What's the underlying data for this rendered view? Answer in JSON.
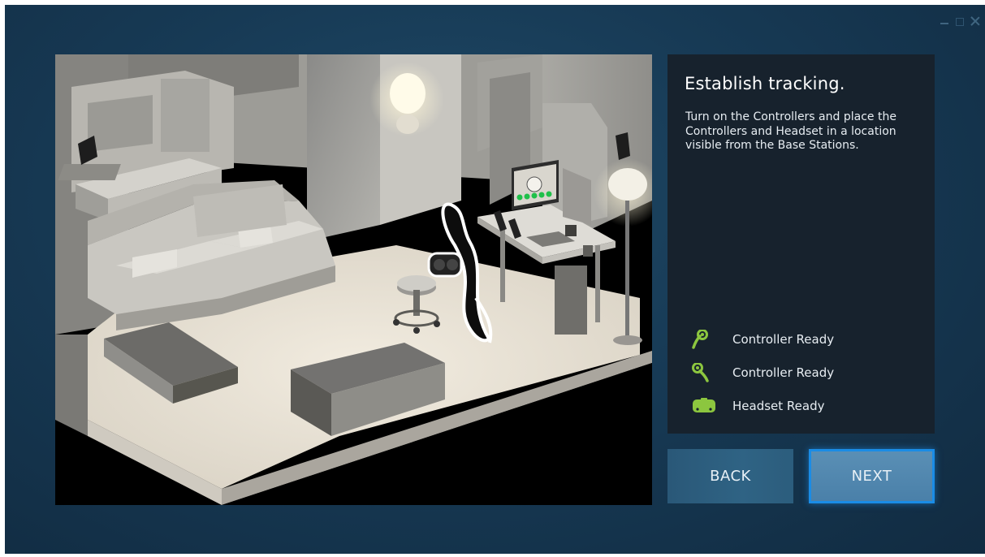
{
  "window": {
    "controls": [
      "minimize",
      "maximize",
      "close"
    ]
  },
  "panel": {
    "title": "Establish tracking.",
    "description": "Turn on the Controllers and place the Controllers and Headset in a location visible from the Base Stations.",
    "status_items": [
      {
        "label": "Controller Ready",
        "icon": "controller-left-icon"
      },
      {
        "label": "Controller Ready",
        "icon": "controller-right-icon"
      },
      {
        "label": "Headset Ready",
        "icon": "headset-icon"
      }
    ],
    "status_color": "#8cc63f"
  },
  "buttons": {
    "back_label": "BACK",
    "next_label": "NEXT"
  },
  "colors": {
    "background": "#173a55",
    "panel": "#17222d",
    "next_border": "#1a8ce6",
    "ready_green": "#8cc63f"
  }
}
